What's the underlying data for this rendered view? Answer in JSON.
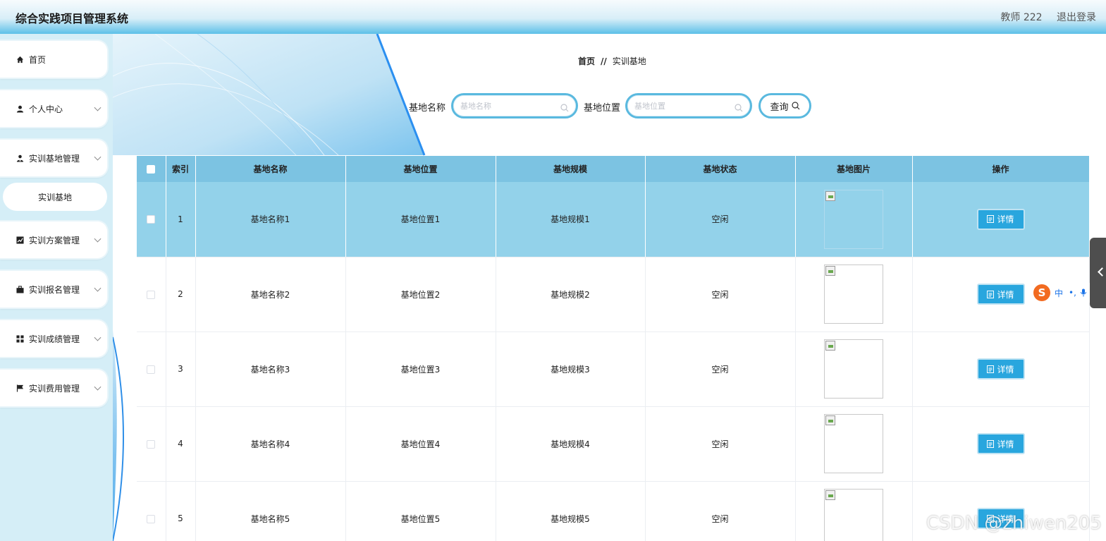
{
  "header": {
    "title": "综合实践项目管理系统",
    "user": "教师 222",
    "logout": "退出登录"
  },
  "sidebar": {
    "items": [
      {
        "label": "首页",
        "icon": "home-icon"
      },
      {
        "label": "个人中心",
        "icon": "user-icon"
      },
      {
        "label": "实训基地管理",
        "icon": "user-tie-icon"
      },
      {
        "label": "实训基地",
        "icon": ""
      },
      {
        "label": "实训方案管理",
        "icon": "chart-icon"
      },
      {
        "label": "实训报名管理",
        "icon": "briefcase-icon"
      },
      {
        "label": "实训成绩管理",
        "icon": "grid-icon"
      },
      {
        "label": "实训费用管理",
        "icon": "flag-icon"
      }
    ]
  },
  "breadcrumb": {
    "home": "首页",
    "sep": "//",
    "current": "实训基地"
  },
  "search": {
    "name_label": "基地名称",
    "name_placeholder": "基地名称",
    "location_label": "基地位置",
    "location_placeholder": "基地位置",
    "query_label": "查询"
  },
  "table": {
    "headers": [
      "索引",
      "基地名称",
      "基地位置",
      "基地规模",
      "基地状态",
      "基地图片",
      "操作"
    ],
    "detail_label": "详情",
    "rows": [
      {
        "index": "1",
        "name": "基地名称1",
        "location": "基地位置1",
        "scale": "基地规模1",
        "status": "空闲"
      },
      {
        "index": "2",
        "name": "基地名称2",
        "location": "基地位置2",
        "scale": "基地规模2",
        "status": "空闲"
      },
      {
        "index": "3",
        "name": "基地名称3",
        "location": "基地位置3",
        "scale": "基地规模3",
        "status": "空闲"
      },
      {
        "index": "4",
        "name": "基地名称4",
        "location": "基地位置4",
        "scale": "基地规模4",
        "status": "空闲"
      },
      {
        "index": "5",
        "name": "基地名称5",
        "location": "基地位置5",
        "scale": "基地规模5",
        "status": "空闲"
      }
    ]
  },
  "ime": {
    "s": "S",
    "mode": "中",
    "punct": "•,"
  },
  "watermark": "CSDN @zhiwen205",
  "colors": {
    "accent": "#29a6de",
    "table_header": "#7cc3e2",
    "highlight_row": "#93d2ea",
    "sidebar_bg": "#d5eef7"
  }
}
